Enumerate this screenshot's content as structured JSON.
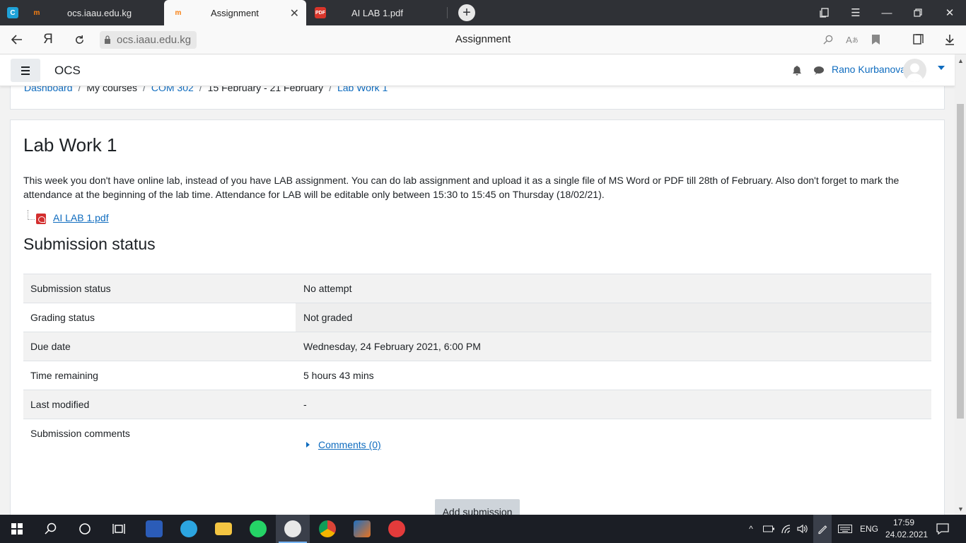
{
  "browser": {
    "tabs": [
      {
        "title": "ocs.iaau.edu.kg"
      },
      {
        "title": "Assignment"
      },
      {
        "title": "AI LAB 1.pdf"
      }
    ],
    "url": "ocs.iaau.edu.kg",
    "page_title": "Assignment"
  },
  "navbar": {
    "brand": "OCS",
    "user_name": "Rano Kurbanova"
  },
  "breadcrumb": [
    {
      "label": "Dashboard"
    },
    {
      "label": "My courses"
    },
    {
      "label": "COM 302"
    },
    {
      "label": "15 February - 21 February"
    },
    {
      "label": "Lab Work 1"
    }
  ],
  "assignment": {
    "title": "Lab Work 1",
    "intro": "This week you don't have online lab, instead of you have LAB assignment. You can do lab assignment and upload it as a single file of MS Word or PDF till 28th of February. Also don't forget to mark the attendance at the beginning of the lab time. Attendance for LAB will be editable only between 15:30 to 15:45 on Thursday (18/02/21).",
    "attachment": "AI LAB 1.pdf"
  },
  "submission": {
    "heading": "Submission status",
    "rows": [
      {
        "label": "Submission status",
        "value": "No attempt"
      },
      {
        "label": "Grading status",
        "value": "Not graded"
      },
      {
        "label": "Due date",
        "value": "Wednesday, 24 February 2021, 6:00 PM"
      },
      {
        "label": "Time remaining",
        "value": "5 hours 43 mins"
      },
      {
        "label": "Last modified",
        "value": "-"
      },
      {
        "label": "Submission comments",
        "value": "Comments (0)"
      }
    ],
    "button": "Add submission"
  },
  "taskbar": {
    "language": "ENG",
    "time": "17:59",
    "date": "24.02.2021"
  },
  "colors": {
    "link": "#0f6cbf",
    "tabstrip": "#2f3136",
    "taskbar": "#1b1e25"
  }
}
